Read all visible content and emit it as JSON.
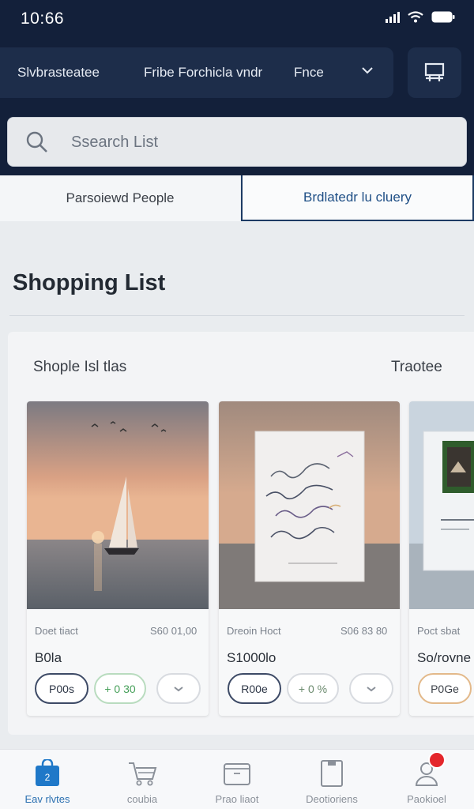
{
  "status": {
    "time": "10:66"
  },
  "filters": [
    {
      "label": "Slvbrasteatee"
    },
    {
      "label": "Fribe Forchicla vndr"
    },
    {
      "label": "Fnce"
    }
  ],
  "search": {
    "placeholder": "Ssearch List"
  },
  "tabs": [
    {
      "label": "Parsoiewd People"
    },
    {
      "label": "Brdlatedr lu cluery"
    }
  ],
  "page": {
    "title": "Shopping List"
  },
  "panel": {
    "title": "Shople Isl tlas",
    "link": "Traotee"
  },
  "products": [
    {
      "meta": "Doet tiact",
      "price": "S60 01,00",
      "name": "B0la",
      "actions": [
        "P00s",
        "+ 0 30",
        ""
      ]
    },
    {
      "meta": "Dreoin Hoct",
      "price": "S06 83 80",
      "name": "S1000lo",
      "actions": [
        "R00e",
        "+ 0 %",
        ""
      ]
    },
    {
      "meta": "Poct sbat",
      "price": "",
      "name": "So/rovne",
      "actions": [
        "P0Ge"
      ]
    }
  ],
  "nav": [
    {
      "label": "Eav rlvtes",
      "icon": "shopping-bag-icon"
    },
    {
      "label": "coubia",
      "icon": "cart-icon"
    },
    {
      "label": "Prao liaot",
      "icon": "folder-icon"
    },
    {
      "label": "Deotioriens",
      "icon": "document-icon"
    },
    {
      "label": "Paokioel",
      "icon": "profile-icon"
    }
  ],
  "colors": {
    "header": "#13203a",
    "accent": "#2a6fb0",
    "badge": "#e4262b"
  }
}
